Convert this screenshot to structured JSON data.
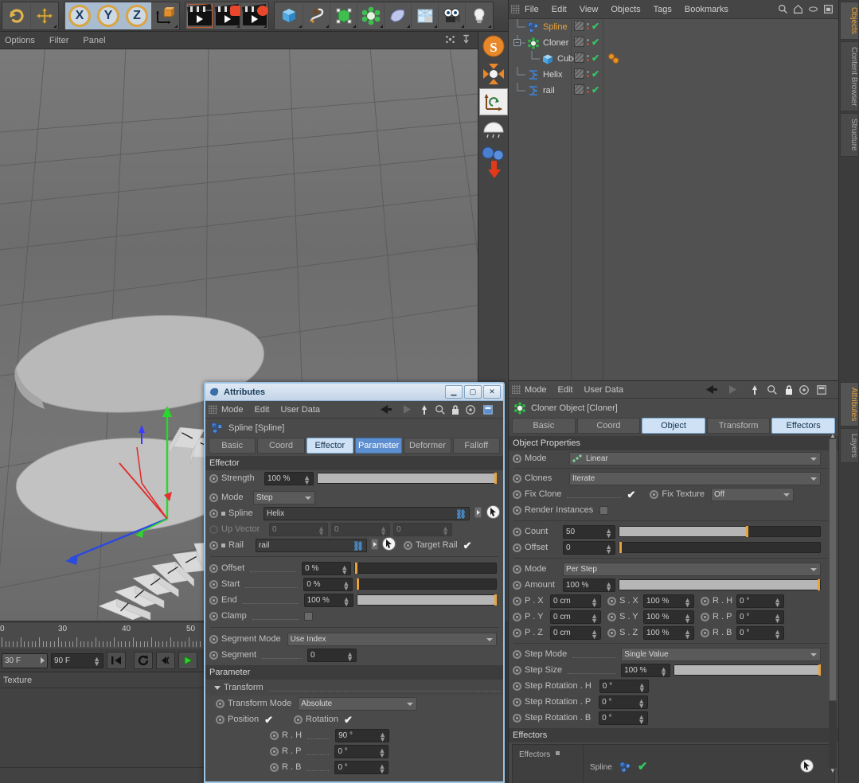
{
  "app": {
    "viewport_label": "3D Viewport"
  },
  "top_toolbar": {
    "buttons": [
      {
        "name": "undo-rotate-icon",
        "label": "Undo"
      },
      {
        "name": "move-tool-icon",
        "label": "Move"
      },
      {
        "name": "axis-x-button",
        "label": "X"
      },
      {
        "name": "axis-y-button",
        "label": "Y"
      },
      {
        "name": "axis-z-button",
        "label": "Z"
      },
      {
        "name": "world-object-axis-icon",
        "label": "World/Object"
      },
      {
        "name": "render-view-icon",
        "label": "Render View"
      },
      {
        "name": "render-region-icon",
        "label": "Render Region"
      },
      {
        "name": "render-settings-icon",
        "label": "Render to Picture Viewer"
      },
      {
        "name": "cube-primitive-icon",
        "label": "Cube"
      },
      {
        "name": "spline-pen-icon",
        "label": "Spline"
      },
      {
        "name": "generator-icon",
        "label": "Generators"
      },
      {
        "name": "mograph-icon",
        "label": "MoGraph"
      },
      {
        "name": "deformer-icon",
        "label": "Deformers"
      },
      {
        "name": "scene-environment-icon",
        "label": "Environment"
      },
      {
        "name": "camera-icon",
        "label": "Camera"
      },
      {
        "name": "light-icon",
        "label": "Light"
      }
    ]
  },
  "viewport_menu": {
    "items": [
      "Options",
      "Filter",
      "Panel"
    ],
    "right_icons": [
      "move-view-icon",
      "scale-view-icon",
      "rotate-view-icon",
      "maximize-view-icon"
    ]
  },
  "right_strip": {
    "buttons": [
      {
        "name": "subdivision-surface-icon",
        "label": "S"
      },
      {
        "name": "symmetry-icon",
        "label": "Symmetry"
      },
      {
        "name": "coordinate-system-icon",
        "label": "Coordinate System"
      },
      {
        "name": "sky-icon",
        "label": "Sky"
      },
      {
        "name": "cloner-drop-icon",
        "label": "Cloner"
      }
    ]
  },
  "timeline": {
    "ruler_labels": [
      "0",
      "30",
      "40",
      "50"
    ],
    "current_frame": "30 F",
    "end_frame": "90 F",
    "controls": [
      "go-to-start-icon",
      "loop-icon",
      "step-back-icon",
      "play-icon"
    ]
  },
  "material_panel": {
    "menu": "Texture"
  },
  "object_manager": {
    "menus": [
      "File",
      "Edit",
      "View",
      "Objects",
      "Tags",
      "Bookmarks"
    ],
    "header_icons": [
      "search-icon",
      "home-icon",
      "eye-icon",
      "layout-icon"
    ],
    "rows": [
      {
        "name": "Spline",
        "icon": "mograph-spline-effector-icon",
        "indent": 0,
        "selected": true,
        "has_tags": true
      },
      {
        "name": "Cloner",
        "icon": "cloner-object-icon",
        "indent": 0,
        "selected": false,
        "has_tags": true,
        "expandable": true
      },
      {
        "name": "Cube",
        "icon": "cube-object-icon",
        "indent": 1,
        "selected": false,
        "has_tags": true,
        "extra_tag": "phong-tag"
      },
      {
        "name": "Helix",
        "icon": "helix-spline-icon",
        "indent": 0,
        "selected": false,
        "has_tags": true
      },
      {
        "name": "rail",
        "icon": "helix-spline-icon",
        "indent": 0,
        "selected": false,
        "has_tags": true
      }
    ]
  },
  "right_vtabs_top": [
    {
      "label": "Objects",
      "active": true
    },
    {
      "label": "Content Browser",
      "active": false
    },
    {
      "label": "Structure",
      "active": false
    }
  ],
  "right_vtabs_bottom": [
    {
      "label": "Attributes",
      "active": true
    },
    {
      "label": "Layers",
      "active": false
    }
  ],
  "attributes_window": {
    "title": "Attributes",
    "window_buttons": [
      "minimize",
      "maximize",
      "close"
    ],
    "menus": [
      "Mode",
      "Edit",
      "User Data"
    ],
    "toolbar_icons": [
      "back-arrow-icon",
      "forward-arrow-icon",
      "pin-icon",
      "search-icon",
      "lock-icon",
      "options-icon",
      "menu-icon"
    ],
    "object_header": "Spline [Spline]",
    "object_icon": "mograph-spline-effector-icon",
    "tabs": [
      {
        "label": "Basic",
        "state": "normal"
      },
      {
        "label": "Coord",
        "state": "normal"
      },
      {
        "label": "Effector",
        "state": "selected"
      },
      {
        "label": "Parameter",
        "state": "selected2"
      },
      {
        "label": "Deformer",
        "state": "normal"
      },
      {
        "label": "Falloff",
        "state": "normal"
      }
    ],
    "effector_section": {
      "title": "Effector",
      "strength": {
        "label": "Strength",
        "value": "100 %",
        "slider_pct": 100
      },
      "mode": {
        "label": "Mode",
        "value": "Step"
      },
      "spline": {
        "label": "Spline",
        "value": "Helix"
      },
      "up_vector": {
        "label": "Up Vector",
        "x": "0",
        "y": "0",
        "z": "0"
      },
      "rail": {
        "label": "Rail",
        "value": "rail",
        "target_rail_label": "Target Rail",
        "target_rail_checked": true
      },
      "offset": {
        "label": "Offset",
        "value": "0 %",
        "slider_pct": 0
      },
      "start": {
        "label": "Start",
        "value": "0 %",
        "slider_pct": 0
      },
      "end": {
        "label": "End",
        "value": "100 %",
        "slider_pct": 100
      },
      "clamp": {
        "label": "Clamp",
        "checked": false
      },
      "segment_mode": {
        "label": "Segment Mode",
        "value": "Use Index"
      },
      "segment": {
        "label": "Segment",
        "value": "0"
      }
    },
    "parameter_section": {
      "title": "Parameter",
      "transform_group": "Transform",
      "transform_mode": {
        "label": "Transform Mode",
        "value": "Absolute"
      },
      "position": {
        "label": "Position",
        "checked": true
      },
      "rotation": {
        "label": "Rotation",
        "checked": true
      },
      "r_h": {
        "label": "R . H",
        "value": "90 °"
      },
      "r_p": {
        "label": "R . P",
        "value": "0 °"
      },
      "r_b": {
        "label": "R . B",
        "value": "0 °"
      }
    }
  },
  "attribute_manager": {
    "menus": [
      "Mode",
      "Edit",
      "User Data"
    ],
    "toolbar_icons": [
      "back-arrow-icon",
      "forward-arrow-icon",
      "pin-icon",
      "search-icon",
      "lock-icon",
      "options-icon",
      "menu-icon"
    ],
    "object_header": "Cloner Object [Cloner]",
    "object_icon": "cloner-object-icon",
    "tabs": [
      {
        "label": "Basic",
        "state": "normal"
      },
      {
        "label": "Coord",
        "state": "normal"
      },
      {
        "label": "Object",
        "state": "selected"
      },
      {
        "label": "Transform",
        "state": "normal"
      },
      {
        "label": "Effectors",
        "state": "selected"
      }
    ],
    "object_properties": {
      "title": "Object Properties",
      "mode": {
        "label": "Mode",
        "value": "Linear",
        "icon": "linear-mode-icon"
      },
      "clones": {
        "label": "Clones",
        "value": "Iterate"
      },
      "fix_clone": {
        "label": "Fix Clone",
        "checked": true
      },
      "fix_texture": {
        "label": "Fix Texture",
        "value": "Off"
      },
      "render_instances": {
        "label": "Render Instances",
        "checked": false
      },
      "count": {
        "label": "Count",
        "value": "50",
        "slider_pct": 63
      },
      "offset": {
        "label": "Offset",
        "value": "0",
        "slider_pct": 0
      },
      "mode2": {
        "label": "Mode",
        "value": "Per Step"
      },
      "amount": {
        "label": "Amount",
        "value": "100 %",
        "slider_pct": 100
      },
      "p_x": {
        "label": "P . X",
        "value": "0 cm"
      },
      "p_y": {
        "label": "P . Y",
        "value": "0 cm"
      },
      "p_z": {
        "label": "P . Z",
        "value": "0 cm"
      },
      "s_x": {
        "label": "S . X",
        "value": "100 %"
      },
      "s_y": {
        "label": "S . Y",
        "value": "100 %"
      },
      "s_z": {
        "label": "S . Z",
        "value": "100 %"
      },
      "r_h": {
        "label": "R . H",
        "value": "0 °"
      },
      "r_p": {
        "label": "R . P",
        "value": "0 °"
      },
      "r_b": {
        "label": "R . B",
        "value": "0 °"
      },
      "step_mode": {
        "label": "Step Mode",
        "value": "Single Value"
      },
      "step_size": {
        "label": "Step Size",
        "value": "100 %",
        "slider_pct": 100
      },
      "step_rotation_h": {
        "label": "Step Rotation . H",
        "value": "0 °"
      },
      "step_rotation_p": {
        "label": "Step Rotation . P",
        "value": "0 °"
      },
      "step_rotation_b": {
        "label": "Step Rotation . B",
        "value": "0 °"
      }
    },
    "effectors_section": {
      "title": "Effectors",
      "list_label": "Effectors",
      "entries": [
        {
          "name": "Spline",
          "icon": "mograph-spline-effector-icon",
          "enabled": true
        }
      ]
    }
  },
  "colors": {
    "accent_orange": "#e8a33d",
    "tab_selected": "#cfe2f5",
    "tab_selected2": "#5d8fd0",
    "check_green": "#35c463",
    "panel_bg": "#4a4a4a",
    "viewport_bg": "#6f6f6f"
  }
}
